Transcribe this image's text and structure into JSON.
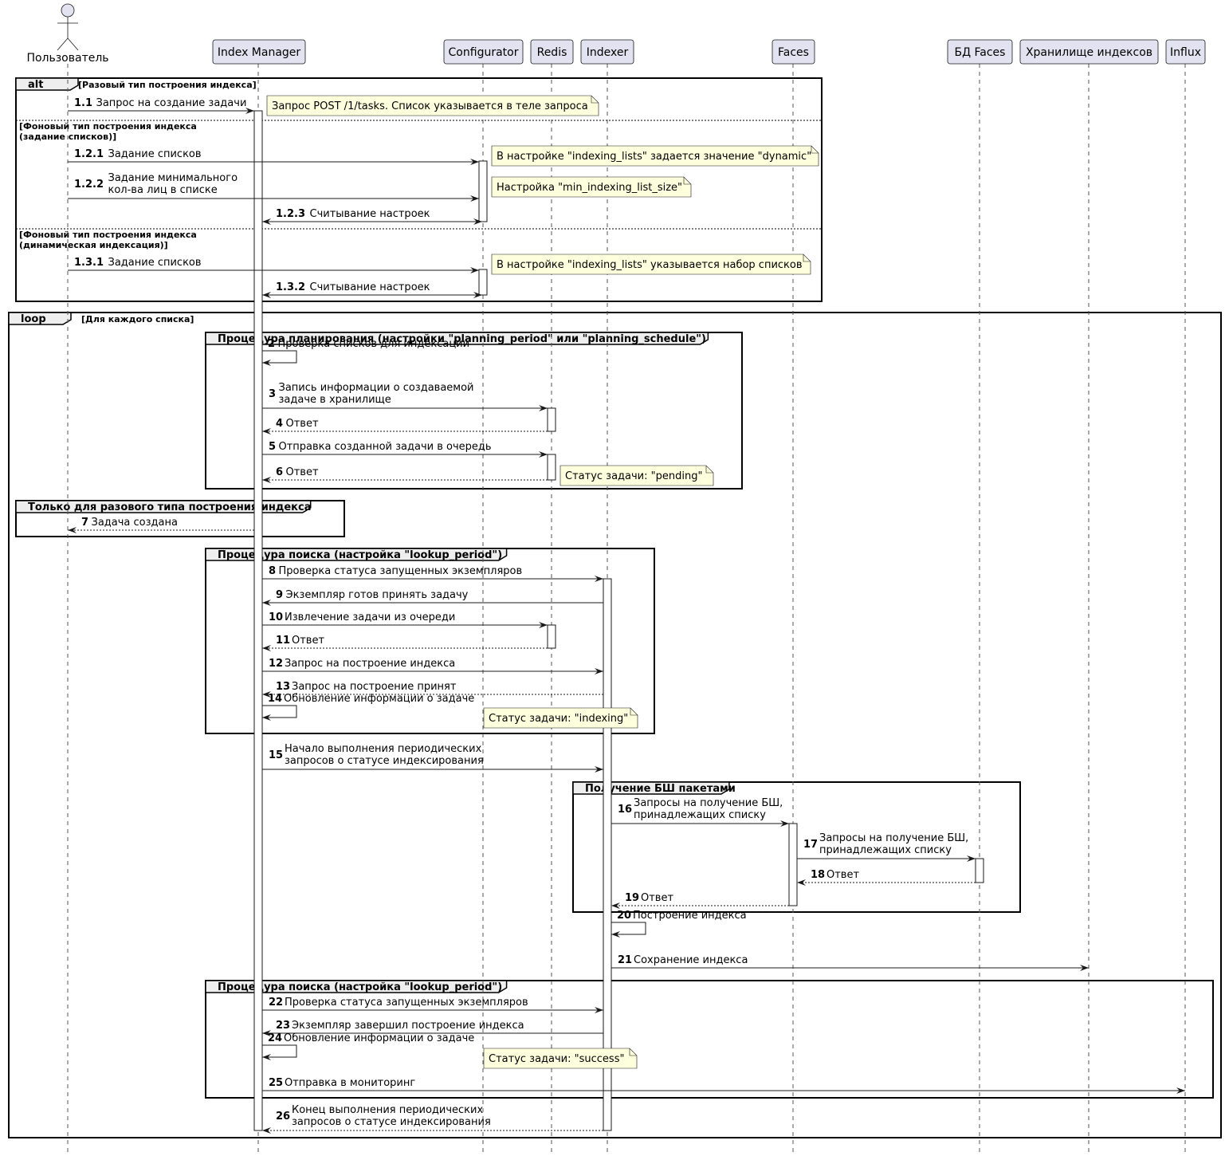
{
  "participants": [
    {
      "id": "user",
      "label": "Пользователь",
      "kind": "actor"
    },
    {
      "id": "im",
      "label": "Index Manager",
      "kind": "box"
    },
    {
      "id": "cfg",
      "label": "Configurator",
      "kind": "box"
    },
    {
      "id": "redis",
      "label": "Redis",
      "kind": "box"
    },
    {
      "id": "idx",
      "label": "Indexer",
      "kind": "box"
    },
    {
      "id": "faces",
      "label": "Faces",
      "kind": "box"
    },
    {
      "id": "db",
      "label": "БД Faces",
      "kind": "box"
    },
    {
      "id": "store",
      "label": "Хранилище индексов",
      "kind": "box"
    },
    {
      "id": "influx",
      "label": "Influx",
      "kind": "box"
    }
  ],
  "frames": [
    {
      "id": "alt",
      "kind": "alt",
      "label": "alt",
      "guards": [
        {
          "text": "[Разовый тип построения индекса]"
        },
        {
          "text": "[Фоновый тип построения индекса",
          "text2": "(задание списков)]"
        },
        {
          "text": "[Фоновый тип построения индекса",
          "text2": "(динамическая индексация)]"
        }
      ]
    },
    {
      "id": "loop",
      "kind": "loop",
      "label": "loop",
      "guards": [
        {
          "text": "[Для каждого списка]"
        }
      ]
    },
    {
      "id": "g1",
      "kind": "group",
      "label": "Процедура планирования (настройки \"planning_period\" или \"planning_schedule\")"
    },
    {
      "id": "g2",
      "kind": "group",
      "label": "Только для разового типа построения индекса"
    },
    {
      "id": "g3",
      "kind": "group",
      "label": "Процедура поиска (настройка \"lookup_period\")"
    },
    {
      "id": "g4",
      "kind": "group",
      "label": "Получение БШ пакетами"
    },
    {
      "id": "g5",
      "kind": "group",
      "label": "Процедура поиска (настройка \"lookup_period\")"
    }
  ],
  "messages": [
    {
      "num": "1.1",
      "text": [
        "Запрос на создание задачи"
      ],
      "from": "user",
      "to": "im",
      "style": "solid"
    },
    {
      "num": "1.2.1",
      "text": [
        "Задание списков"
      ],
      "from": "user",
      "to": "cfg",
      "style": "solid"
    },
    {
      "num": "1.2.2",
      "text": [
        "Задание минимального",
        "кол-ва лиц в списке"
      ],
      "from": "user",
      "to": "cfg",
      "style": "solid"
    },
    {
      "num": "1.2.3",
      "text": [
        "Считывание настроек"
      ],
      "from": "im",
      "to": "cfg",
      "style": "both"
    },
    {
      "num": "1.3.1",
      "text": [
        "Задание списков"
      ],
      "from": "user",
      "to": "cfg",
      "style": "solid"
    },
    {
      "num": "1.3.2",
      "text": [
        "Считывание настроек"
      ],
      "from": "im",
      "to": "cfg",
      "style": "both"
    },
    {
      "num": "2",
      "text": [
        "Проверка списков для индексации"
      ],
      "from": "im",
      "to": "im",
      "style": "self"
    },
    {
      "num": "3",
      "text": [
        "Запись информации о создаваемой",
        "задаче в хранилище"
      ],
      "from": "im",
      "to": "redis",
      "style": "solid"
    },
    {
      "num": "4",
      "text": [
        "Ответ"
      ],
      "from": "redis",
      "to": "im",
      "style": "dashed"
    },
    {
      "num": "5",
      "text": [
        "Отправка созданной задачи в очередь"
      ],
      "from": "im",
      "to": "redis",
      "style": "solid"
    },
    {
      "num": "6",
      "text": [
        "Ответ"
      ],
      "from": "redis",
      "to": "im",
      "style": "dashed"
    },
    {
      "num": "7",
      "text": [
        "Задача создана"
      ],
      "from": "im",
      "to": "user",
      "style": "dashed"
    },
    {
      "num": "8",
      "text": [
        "Проверка статуса запущенных экземпляров"
      ],
      "from": "im",
      "to": "idx",
      "style": "solid"
    },
    {
      "num": "9",
      "text": [
        "Экземпляр готов принять задачу"
      ],
      "from": "idx",
      "to": "im",
      "style": "solid"
    },
    {
      "num": "10",
      "text": [
        "Извлечение задачи из очереди"
      ],
      "from": "im",
      "to": "redis",
      "style": "solid"
    },
    {
      "num": "11",
      "text": [
        "Ответ"
      ],
      "from": "redis",
      "to": "im",
      "style": "dashed"
    },
    {
      "num": "12",
      "text": [
        "Запрос на построение индекса"
      ],
      "from": "im",
      "to": "idx",
      "style": "solid"
    },
    {
      "num": "13",
      "text": [
        "Запрос на построение принят"
      ],
      "from": "idx",
      "to": "im",
      "style": "dashed"
    },
    {
      "num": "14",
      "text": [
        "Обновление информации о задаче"
      ],
      "from": "im",
      "to": "im",
      "style": "self"
    },
    {
      "num": "15",
      "text": [
        "Начало выполнения периодических",
        "запросов о статусе индексирования"
      ],
      "from": "im",
      "to": "idx",
      "style": "solid"
    },
    {
      "num": "16",
      "text": [
        "Запросы на получение БШ,",
        "принадлежащих списку"
      ],
      "from": "idx",
      "to": "faces",
      "style": "solid"
    },
    {
      "num": "17",
      "text": [
        "Запросы на получение БШ,",
        "принадлежащих списку"
      ],
      "from": "faces",
      "to": "db",
      "style": "solid"
    },
    {
      "num": "18",
      "text": [
        "Ответ"
      ],
      "from": "db",
      "to": "faces",
      "style": "dashed"
    },
    {
      "num": "19",
      "text": [
        "Ответ"
      ],
      "from": "faces",
      "to": "idx",
      "style": "dashed"
    },
    {
      "num": "20",
      "text": [
        "Построение индекса"
      ],
      "from": "idx",
      "to": "idx",
      "style": "self"
    },
    {
      "num": "21",
      "text": [
        "Сохранение индекса"
      ],
      "from": "idx",
      "to": "store",
      "style": "solid"
    },
    {
      "num": "22",
      "text": [
        "Проверка статуса запущенных экземпляров"
      ],
      "from": "im",
      "to": "idx",
      "style": "solid"
    },
    {
      "num": "23",
      "text": [
        "Экземпляр завершил построение индекса"
      ],
      "from": "idx",
      "to": "im",
      "style": "solid"
    },
    {
      "num": "24",
      "text": [
        "Обновление информации о задаче"
      ],
      "from": "im",
      "to": "im",
      "style": "self"
    },
    {
      "num": "25",
      "text": [
        "Отправка в мониторинг"
      ],
      "from": "im",
      "to": "influx",
      "style": "solid"
    },
    {
      "num": "26",
      "text": [
        "Конец выполнения периодических",
        "запросов о статусе индексирования"
      ],
      "from": "idx",
      "to": "im",
      "style": "dashed"
    }
  ],
  "notes": [
    {
      "text": "Запрос POST /1/tasks. Список указывается в теле запроса"
    },
    {
      "text": "В настройке \"indexing_lists\" задается значение \"dynamic\""
    },
    {
      "text": "Настройка \"min_indexing_list_size\""
    },
    {
      "text": "В настройке \"indexing_lists\" указывается набор списков"
    },
    {
      "text": "Статус задачи: \"pending\""
    },
    {
      "text": "Статус задачи: \"indexing\""
    },
    {
      "text": "Статус задачи: \"success\""
    }
  ]
}
